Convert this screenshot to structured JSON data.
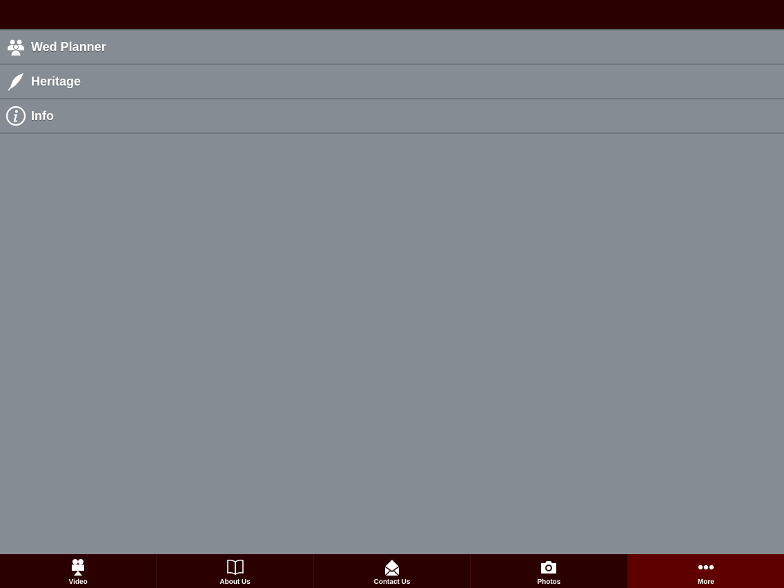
{
  "colors": {
    "bar_bg": "#2b0000",
    "active_tab_bg": "#5e0000",
    "page_bg": "#858c94",
    "text": "#ffffff"
  },
  "menu": {
    "items": [
      {
        "label": "Wed Planner",
        "icon": "group-icon"
      },
      {
        "label": "Heritage",
        "icon": "feather-icon"
      },
      {
        "label": "Info",
        "icon": "info-icon"
      }
    ]
  },
  "tabbar": {
    "tabs": [
      {
        "label": "Video",
        "icon": "video-camera-icon",
        "active": false
      },
      {
        "label": "About Us",
        "icon": "book-icon",
        "active": false
      },
      {
        "label": "Contact Us",
        "icon": "envelope-icon",
        "active": false
      },
      {
        "label": "Photos",
        "icon": "camera-icon",
        "active": false
      },
      {
        "label": "More",
        "icon": "more-dots-icon",
        "active": true
      }
    ]
  }
}
